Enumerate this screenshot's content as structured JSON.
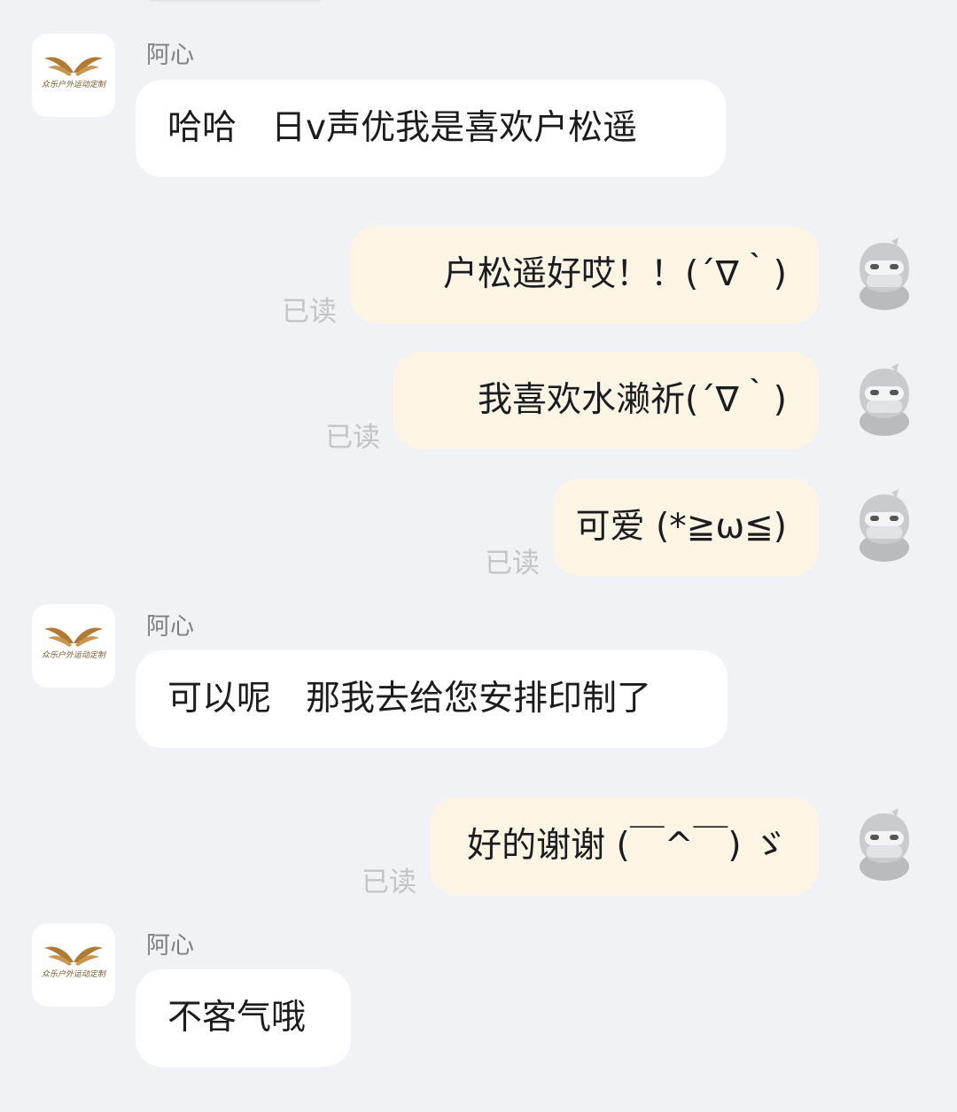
{
  "contact": {
    "name": "阿心",
    "logo_text": "众乐户外运动定制"
  },
  "messages": [
    {
      "side": "in",
      "sender": "阿心",
      "text": "哈哈　日v声优我是喜欢户松遥"
    },
    {
      "side": "out",
      "text": "户松遥好哎！！(´∇｀)",
      "status": "已读"
    },
    {
      "side": "out",
      "text": "我喜欢水濑祈(´∇｀)",
      "status": "已读"
    },
    {
      "side": "out",
      "text": "可爱 (*≧ω≦)",
      "status": "已读"
    },
    {
      "side": "in",
      "sender": "阿心",
      "text": "可以呢　那我去给您安排印制了"
    },
    {
      "side": "out",
      "text": "好的谢谢 (￣^￣) ゞ",
      "status": "已读"
    },
    {
      "side": "in",
      "sender": "阿心",
      "text": "不客气哦"
    }
  ],
  "icons": {
    "contact_avatar": "brand-wings-logo",
    "self_avatar": "ninja-avatar"
  },
  "colors": {
    "background": "#f1f2f5",
    "incoming_bubble": "#ffffff",
    "outgoing_bubble": "#fcf5e6",
    "read_status": "#c3c4c8",
    "logo_gold": "#b07a33"
  }
}
